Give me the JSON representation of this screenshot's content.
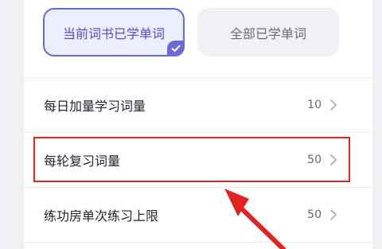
{
  "scope_tabs": [
    {
      "label": "当前词书已学单词",
      "selected": true
    },
    {
      "label": "全部已学单词",
      "selected": false
    }
  ],
  "settings": [
    {
      "label": "每日加量学习词量",
      "value": "10"
    },
    {
      "label": "每轮复习词量",
      "value": "50"
    },
    {
      "label": "练功房单次练习上限",
      "value": "50"
    }
  ],
  "annotation": {
    "highlight_color": "#e02424",
    "arrow_color": "#e02424"
  },
  "colors": {
    "accent": "#6a6ad6",
    "accent_text": "#4f4fc8"
  }
}
